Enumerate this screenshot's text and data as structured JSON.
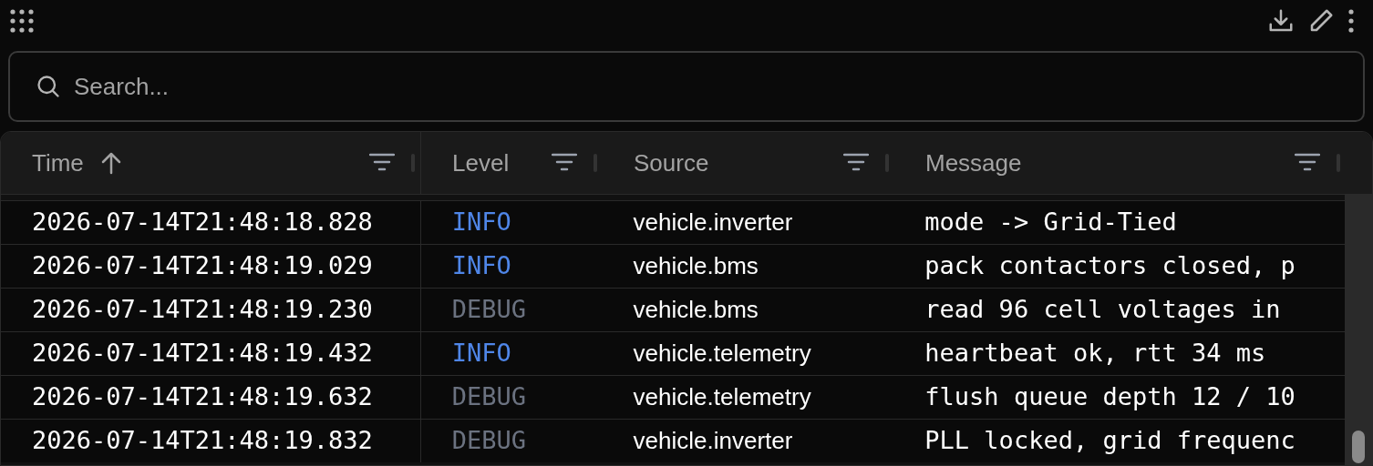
{
  "search": {
    "placeholder": "Search..."
  },
  "table": {
    "columns": [
      {
        "label": "Time",
        "sorted": true
      },
      {
        "label": "Level",
        "sorted": false
      },
      {
        "label": "Source",
        "sorted": false
      },
      {
        "label": "Message",
        "sorted": false
      }
    ],
    "rows": [
      {
        "time": "2026-07-14T21:48:18.828",
        "severity": "INFO",
        "kind": "info",
        "source": "vehicle.inverter",
        "message": "mode -> Grid-Tied"
      },
      {
        "time": "2026-07-14T21:48:19.029",
        "severity": "INFO",
        "kind": "info",
        "source": "vehicle.bms",
        "message": "pack contactors closed, p"
      },
      {
        "time": "2026-07-14T21:48:19.230",
        "severity": "DEBUG",
        "kind": "debug",
        "source": "vehicle.bms",
        "message": "read 96 cell voltages in"
      },
      {
        "time": "2026-07-14T21:48:19.432",
        "severity": "INFO",
        "kind": "info",
        "source": "vehicle.telemetry",
        "message": "heartbeat ok, rtt 34 ms"
      },
      {
        "time": "2026-07-14T21:48:19.632",
        "severity": "DEBUG",
        "kind": "debug",
        "source": "vehicle.telemetry",
        "message": "flush queue depth 12 / 10"
      },
      {
        "time": "2026-07-14T21:48:19.832",
        "severity": "DEBUG",
        "kind": "debug",
        "source": "vehicle.inverter",
        "message": "PLL locked, grid frequenc"
      }
    ]
  }
}
